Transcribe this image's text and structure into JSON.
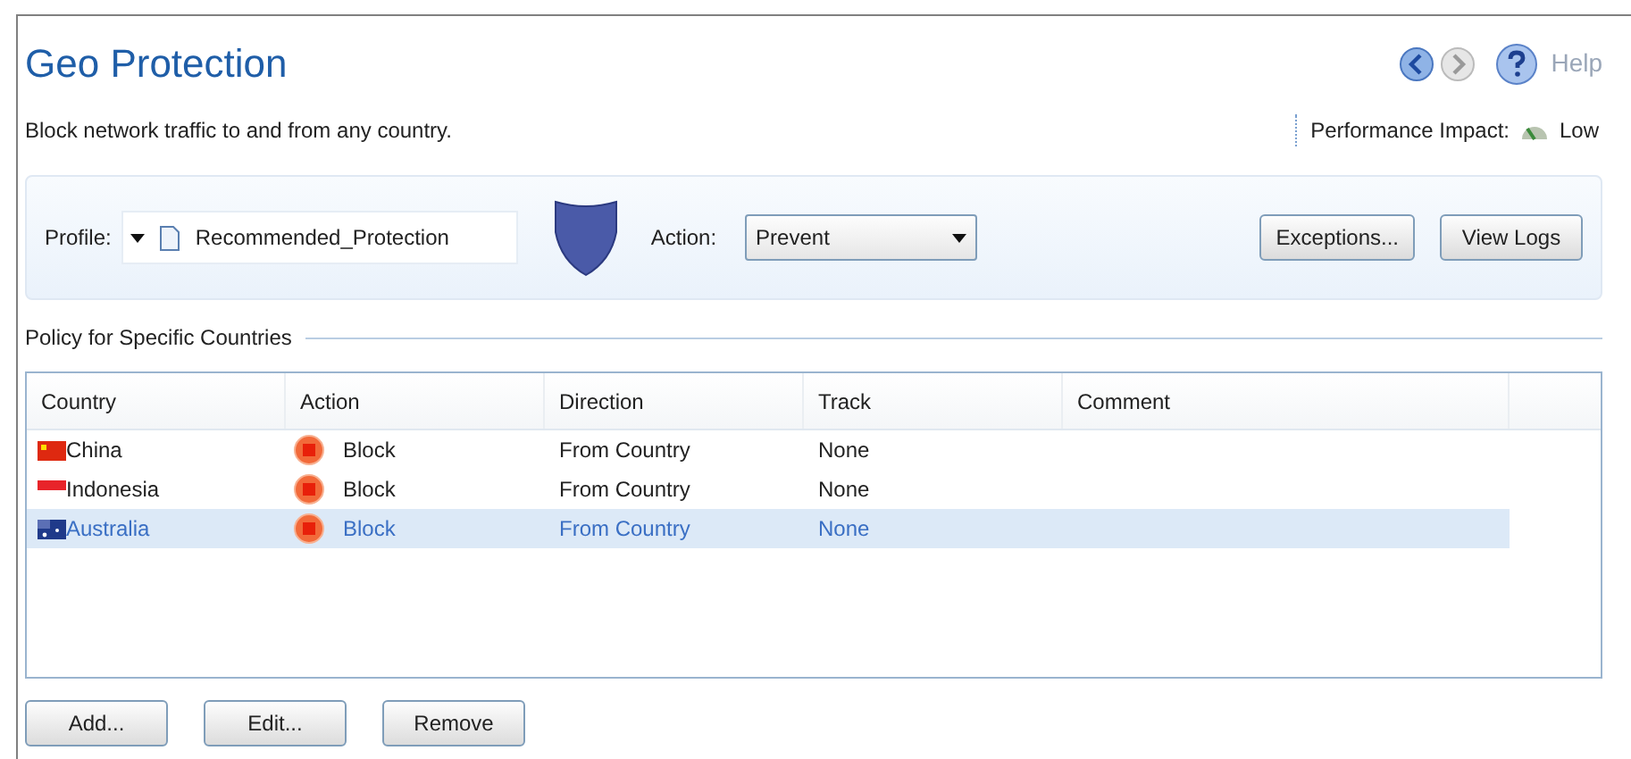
{
  "header": {
    "title": "Geo Protection",
    "help": "Help",
    "description": "Block network traffic to and from any country.",
    "performance_label": "Performance Impact:",
    "performance_value": "Low"
  },
  "toolbar": {
    "profile_label": "Profile:",
    "profile_value": "Recommended_Protection",
    "action_label": "Action:",
    "action_value": "Prevent",
    "buttons": [
      "Exceptions...",
      "View Logs"
    ]
  },
  "section_title": "Policy for Specific Countries",
  "table": {
    "columns": [
      "Country",
      "Action",
      "Direction",
      "Track",
      "Comment"
    ],
    "rows": [
      {
        "kind": "cn",
        "country": "China",
        "action": "Block",
        "direction": "From Country",
        "track": "None",
        "selected": false
      },
      {
        "kind": "id",
        "country": "Indonesia",
        "action": "Block",
        "direction": "From Country",
        "track": "None",
        "selected": false
      },
      {
        "kind": "au",
        "country": "Australia",
        "action": "Block",
        "direction": "From Country",
        "track": "None",
        "selected": true
      }
    ]
  },
  "buttons": [
    "Add...",
    "Edit...",
    "Remove"
  ]
}
